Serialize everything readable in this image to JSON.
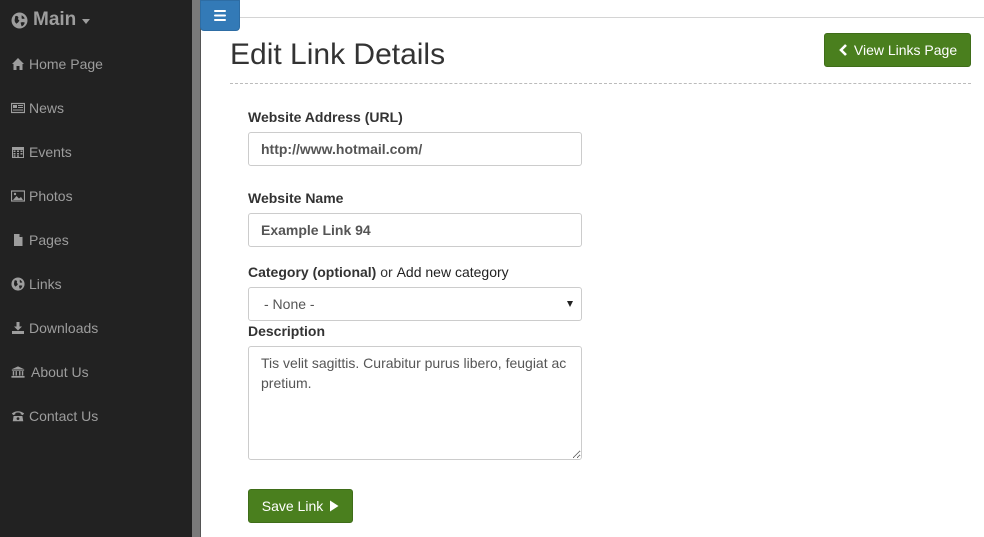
{
  "sidebar": {
    "brand": "Main",
    "items": [
      {
        "label": "Home Page",
        "icon": "home-icon"
      },
      {
        "label": "News",
        "icon": "newspaper-icon"
      },
      {
        "label": "Events",
        "icon": "calendar-icon"
      },
      {
        "label": "Photos",
        "icon": "picture-icon"
      },
      {
        "label": "Pages",
        "icon": "file-icon"
      },
      {
        "label": "Links",
        "icon": "globe-icon"
      },
      {
        "label": "Downloads",
        "icon": "download-icon"
      },
      {
        "label": "About Us",
        "icon": "institution-icon"
      },
      {
        "label": "Contact Us",
        "icon": "phone-icon"
      }
    ]
  },
  "header": {
    "title": "Edit Link Details",
    "view_links_label": "View Links Page"
  },
  "form": {
    "url_label": "Website Address (URL)",
    "url_value": "http://www.hotmail.com/",
    "name_label": "Website Name",
    "name_value": "Example Link 94",
    "category_label": "Category (optional)",
    "category_or": "or",
    "category_add_link": "Add new category",
    "category_selected": "- None -",
    "description_label": "Description",
    "description_value": "Tis velit sagittis. Curabitur purus libero, feugiat ac pretium.",
    "save_label": "Save Link"
  },
  "colors": {
    "sidebar_bg": "#222222",
    "toggle_blue": "#337ab7",
    "button_green": "#4a7f1e"
  }
}
